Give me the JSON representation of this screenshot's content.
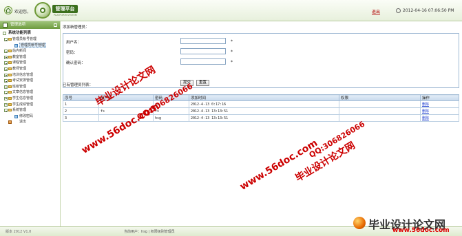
{
  "header": {
    "welcome": "欢迎您，",
    "logo_title": "管理平台",
    "logo_sub": "PLATFORM SYSTEM",
    "logout": "退出",
    "datetime": "2012-04-16 07:06:50 PM"
  },
  "sidebar": {
    "title": "管理选项",
    "root": "系统功能列表",
    "items": [
      {
        "label": "管理员帐号管理",
        "level": 1
      },
      {
        "label": "管理员帐号管理",
        "level": 2,
        "active": true
      },
      {
        "label": "站内新闻",
        "level": 1
      },
      {
        "label": "教室管理",
        "level": 1
      },
      {
        "label": "课程管理",
        "level": 1
      },
      {
        "label": "教师管理",
        "level": 1
      },
      {
        "label": "培训信息管理",
        "level": 1
      },
      {
        "label": "考试安排管理",
        "level": 1
      },
      {
        "label": "班级管理",
        "level": 1
      },
      {
        "label": "文章信息管理",
        "level": 1
      },
      {
        "label": "学生信息管理",
        "level": 1
      },
      {
        "label": "学生成绩管理",
        "level": 1
      },
      {
        "label": "系统管理",
        "level": 1
      },
      {
        "label": "修改密码",
        "level": 2
      },
      {
        "label": "退出",
        "level": 2,
        "exit": true
      }
    ]
  },
  "form": {
    "title": "添加新管理员：",
    "username_label": "用户名：",
    "password_label": "密码：",
    "confirm_label": "确认密码：",
    "required_mark": "*",
    "submit": "提交",
    "reset": "重置"
  },
  "table": {
    "title": "已有管理员列表：",
    "headers": [
      "序号",
      "用户名",
      "密码",
      "添加时间",
      "权限",
      "操作"
    ],
    "rows": [
      [
        "1",
        "",
        "cc",
        "2012-4-13 0:17:16",
        "",
        "删除"
      ],
      [
        "2",
        "fs",
        "fs",
        "2012-4-13 13:13:51",
        "",
        "删除"
      ],
      [
        "3",
        "",
        "hsg",
        "2012-4-13 13:13:51",
        "",
        "删除"
      ]
    ]
  },
  "footer": {
    "version": "版本 2012 V1.0",
    "current_user": "当前用户：hsg | 权限级别管理员"
  },
  "watermarks": {
    "site": "www.56doc.com",
    "qq": "QQ:306826066",
    "brand": "毕业设计论文网",
    "url": "www.56doc.com"
  }
}
